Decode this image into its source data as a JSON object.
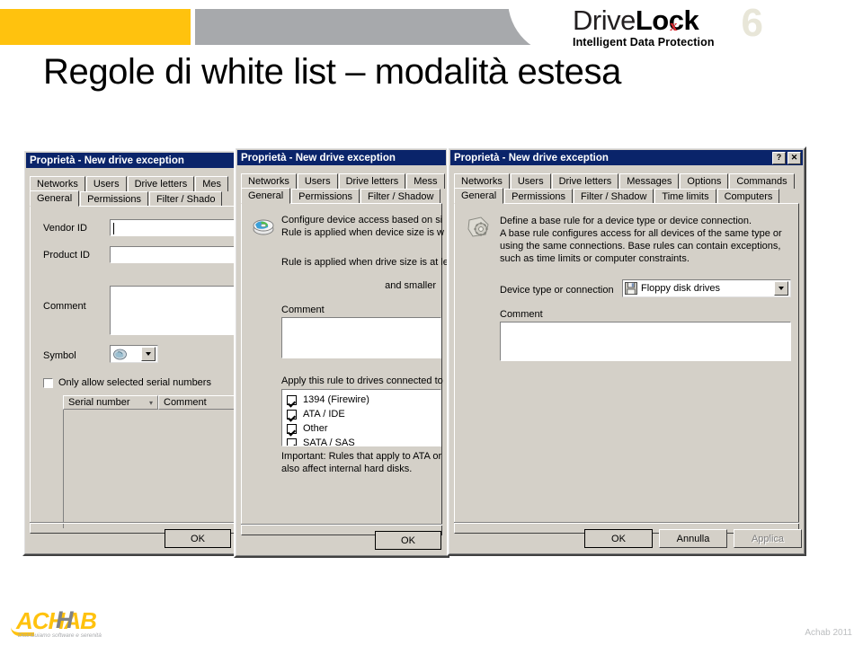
{
  "header": {
    "logo": {
      "brand_part1": "Drive",
      "brand_part2": "Lock",
      "version": "6",
      "x_mark": "x",
      "tagline": "Intelligent Data Protection"
    },
    "accent_yellow": "#FFC20E",
    "accent_gray": "#A7A9AC"
  },
  "slide": {
    "title": "Regole di white list – modalità estesa"
  },
  "dialog1": {
    "title": "Proprietà - New drive exception",
    "tabs_row1": [
      "Networks",
      "Users",
      "Drive letters",
      "Mes"
    ],
    "tabs_row2": [
      "General",
      "Permissions",
      "Filter / Shado"
    ],
    "selected_tab": "General",
    "fields": {
      "vendor_id_label": "Vendor ID",
      "vendor_id_value": "",
      "product_id_label": "Product ID",
      "product_id_value": "",
      "comment_label": "Comment",
      "comment_value": "",
      "symbol_label": "Symbol",
      "symbol_value": ""
    },
    "checkbox": {
      "label": "Only allow selected serial numbers",
      "checked": false
    },
    "list_columns": [
      "Serial number",
      "Comment"
    ],
    "list_rows": [],
    "buttons": {
      "ok": "OK"
    }
  },
  "dialog2": {
    "title": "Proprietà - New drive exception",
    "tabs_row1": [
      "Networks",
      "Users",
      "Drive letters",
      "Mess"
    ],
    "tabs_row2": [
      "General",
      "Permissions",
      "Filter / Shadow"
    ],
    "selected_tab": "General",
    "intro_line1": "Configure device access based on si",
    "intro_line2": "Rule is applied when device size is w",
    "rule_line": "Rule is applied when drive size is at le",
    "and_smaller": "and smaller",
    "comment_label": "Comment",
    "comment_value": "",
    "apply_label": "Apply this rule to drives connected to",
    "connections": [
      {
        "label": "1394 (Firewire)",
        "checked": true
      },
      {
        "label": "ATA / IDE",
        "checked": true
      },
      {
        "label": "Other",
        "checked": true
      },
      {
        "label": "SATA / SAS",
        "checked": true
      }
    ],
    "important_line1": "Important: Rules that apply to ATA or",
    "important_line2": "also affect internal hard disks.",
    "buttons": {
      "ok": "OK"
    }
  },
  "dialog3": {
    "title": "Proprietà - New drive exception",
    "titlebar_buttons": [
      "?",
      "✕"
    ],
    "tabs_row1": [
      "Networks",
      "Users",
      "Drive letters",
      "Messages",
      "Options",
      "Commands"
    ],
    "tabs_row2": [
      "General",
      "Permissions",
      "Filter / Shadow",
      "Time limits",
      "Computers"
    ],
    "selected_tab": "General",
    "description": [
      "Define a base rule for a device type or device connection.",
      "A base rule configures access for all devices of the same type or",
      "using the same connections. Base rules can contain exceptions,",
      "such as time limits or computer constraints."
    ],
    "device_type_label": "Device type or connection",
    "device_type_value": "Floppy disk drives",
    "comment_label": "Comment",
    "comment_value": "",
    "buttons": {
      "ok": "OK",
      "cancel": "Annulla",
      "apply": "Applica"
    }
  },
  "footer": {
    "logo_text": "ACHAB",
    "logo_h": "H",
    "logo_tagline": "Distribuiamo software e serenità",
    "copyright": "Achab 2011"
  }
}
